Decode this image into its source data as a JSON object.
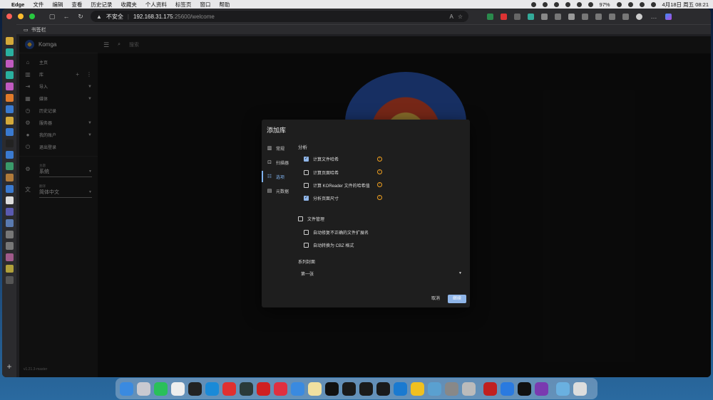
{
  "menubar": {
    "apple": "",
    "app_name": "Edge",
    "items": [
      "文件",
      "编辑",
      "查看",
      "历史记录",
      "收藏夹",
      "个人资料",
      "标签页",
      "窗口",
      "帮助"
    ],
    "battery": "97%",
    "datetime": "4月18日 周五  08:21"
  },
  "browser": {
    "insecure_label": "不安全",
    "url_host": "192.168.31.175",
    "url_rest": ":25600/welcome",
    "bookmarks_label": "书签栏"
  },
  "komga": {
    "app_name": "Komga",
    "search_placeholder": "搜索",
    "nav": {
      "home": "主页",
      "libraries": "库",
      "import": "导入",
      "media": "媒体",
      "history": "历史记录",
      "server": "服务器",
      "account": "我的账户",
      "logout": "退出登录"
    },
    "theme": {
      "label": "主题",
      "value": "系统"
    },
    "language": {
      "label": "翻译",
      "value": "简体中文"
    },
    "version": "v1.21.3-master"
  },
  "dialog": {
    "title": "添加库",
    "tabs": [
      {
        "label": "常规",
        "icon": "book-icon"
      },
      {
        "label": "扫描器",
        "icon": "scanner-icon"
      },
      {
        "label": "选项",
        "icon": "tune-icon"
      },
      {
        "label": "元数据",
        "icon": "metadata-icon"
      }
    ],
    "analysis_label": "分析",
    "options": [
      {
        "label": "计算文件哈希",
        "checked": true
      },
      {
        "label": "计算页面哈希",
        "checked": false
      },
      {
        "label": "计算 KOReader 文件的哈希值",
        "checked": false
      },
      {
        "label": "分析页面尺寸",
        "checked": true
      }
    ],
    "file_management": {
      "label": "文件管理",
      "checked": false
    },
    "file_options": [
      {
        "label": "自动修复不正确的文件扩展名",
        "checked": false
      },
      {
        "label": "自动转换为 CBZ 格式",
        "checked": false
      }
    ],
    "series_cover_label": "系列封面",
    "series_cover_value": "第一张",
    "cancel_label": "取消",
    "next_label": "继续"
  },
  "colors": {
    "accent": "#8fb5e8",
    "warning": "#f0a020"
  }
}
